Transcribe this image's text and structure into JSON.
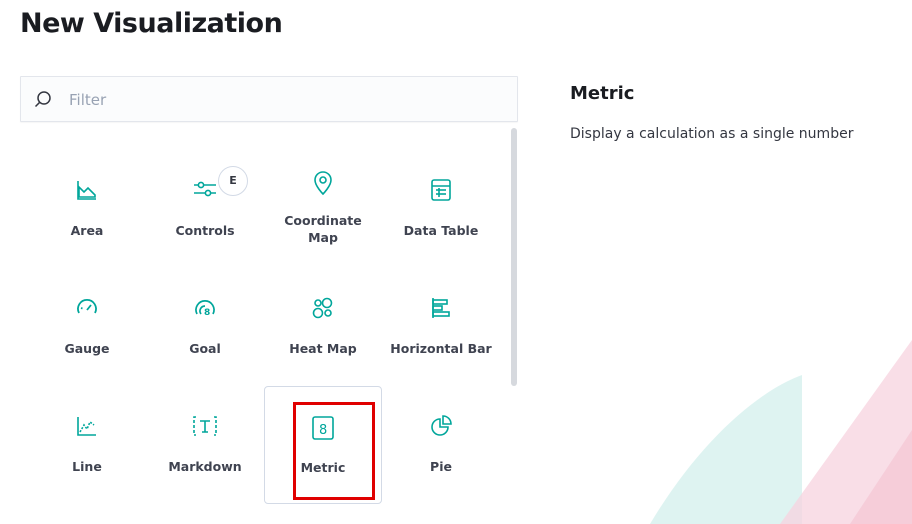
{
  "page": {
    "title": "New Visualization"
  },
  "filter": {
    "placeholder": "Filter",
    "value": ""
  },
  "types": [
    {
      "label": "Area",
      "icon": "area-chart-icon"
    },
    {
      "label": "Controls",
      "icon": "controls-icon",
      "badge": "E"
    },
    {
      "label": "Coordinate Map",
      "icon": "map-pin-icon"
    },
    {
      "label": "Data Table",
      "icon": "data-table-icon"
    },
    {
      "label": "Gauge",
      "icon": "gauge-icon"
    },
    {
      "label": "Goal",
      "icon": "goal-icon"
    },
    {
      "label": "Heat Map",
      "icon": "heat-map-icon"
    },
    {
      "label": "Horizontal Bar",
      "icon": "horizontal-bar-icon"
    },
    {
      "label": "Line",
      "icon": "line-chart-icon"
    },
    {
      "label": "Markdown",
      "icon": "markdown-icon"
    },
    {
      "label": "Metric",
      "icon": "metric-icon",
      "selected": true
    },
    {
      "label": "Pie",
      "icon": "pie-chart-icon"
    }
  ],
  "detail": {
    "title": "Metric",
    "description": "Display a calculation as a single number"
  },
  "colors": {
    "icon": "#00a69b",
    "highlight": "#e00000",
    "deco_teal": "#d6f0ee",
    "deco_pink": "#f7d3df"
  }
}
